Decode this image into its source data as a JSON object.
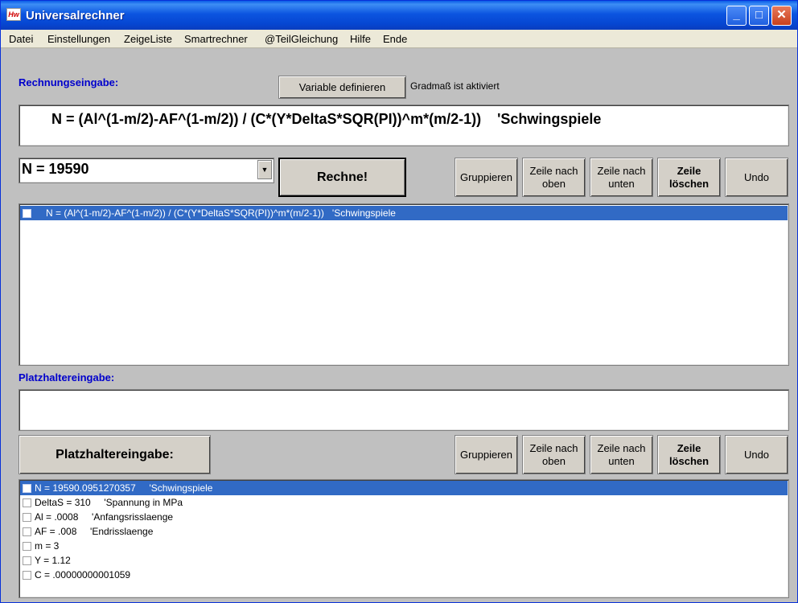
{
  "titlebar": {
    "title": "Universalrechner",
    "icon_text": "Hw",
    "buttons": {
      "minimize": "_",
      "maximize": "□",
      "close": "✕"
    }
  },
  "menubar": {
    "items": [
      "Datei",
      "Einstellungen",
      "ZeigeListe",
      "Smartrechner",
      "@TeilGleichung",
      "Hilfe",
      "Ende"
    ]
  },
  "input_section": {
    "label": "Rechnungseingabe:",
    "define_variable_button": "Variable definieren",
    "status": "Gradmaß ist aktiviert",
    "formula": "N = (Al^(1-m/2)-AF^(1-m/2)) / (C*(Y*DeltaS*SQR(PI))^m*(m/2-1))    'Schwingspiele"
  },
  "result_combo": {
    "value": "N = 19590",
    "arrow": "▼"
  },
  "compute_button": "Rechne!",
  "toolbar_top": {
    "group": "Gruppieren",
    "row_up_1": "Zeile nach",
    "row_up_2": "oben",
    "row_down_1": "Zeile nach",
    "row_down_2": "unten",
    "delete_1": "Zeile",
    "delete_2": "löschen",
    "undo": "Undo"
  },
  "formula_list": {
    "rows": [
      {
        "text": "N = (Al^(1-m/2)-AF^(1-m/2)) / (C*(Y*DeltaS*SQR(PI))^m*(m/2-1))   'Schwingspiele",
        "selected": true
      }
    ]
  },
  "placeholder_section": {
    "label": "Platzhaltereingabe:",
    "input_value": "",
    "button": "Platzhaltereingabe:"
  },
  "toolbar_bottom": {
    "group": "Gruppieren",
    "row_up_1": "Zeile nach",
    "row_up_2": "oben",
    "row_down_1": "Zeile nach",
    "row_down_2": "unten",
    "delete_1": "Zeile",
    "delete_2": "löschen",
    "undo": "Undo"
  },
  "variable_list": {
    "rows": [
      {
        "text": "N = 19590.0951270357     'Schwingspiele",
        "selected": true
      },
      {
        "text": "DeltaS = 310     'Spannung in MPa",
        "selected": false
      },
      {
        "text": "Al = .0008     'Anfangsrisslaenge",
        "selected": false
      },
      {
        "text": "AF = .008     'Endrisslaenge",
        "selected": false
      },
      {
        "text": "m = 3",
        "selected": false
      },
      {
        "text": "Y = 1.12",
        "selected": false
      },
      {
        "text": "C = .00000000001059",
        "selected": false
      }
    ]
  },
  "colors": {
    "titlebar": "#0a4fd8",
    "label_blue": "#0000cc",
    "selection": "#316ac5",
    "face": "#c0c0c0"
  }
}
